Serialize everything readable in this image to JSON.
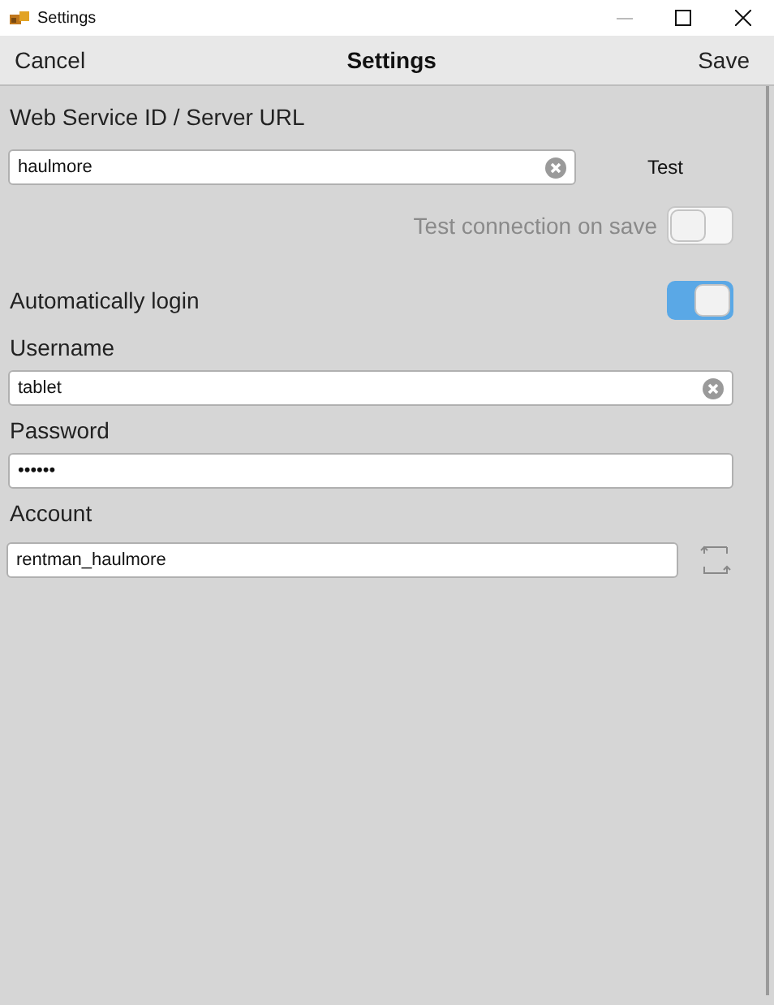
{
  "window": {
    "title": "Settings"
  },
  "nav": {
    "cancel": "Cancel",
    "title": "Settings",
    "save": "Save"
  },
  "server": {
    "label": "Web Service ID / Server URL",
    "value": "haulmore",
    "test": "Test"
  },
  "test_on_save": {
    "label": "Test connection on save",
    "on": false,
    "disabled": true
  },
  "auto_login": {
    "label": "Automatically login",
    "on": true
  },
  "username": {
    "label": "Username",
    "value": "tablet"
  },
  "password": {
    "label": "Password",
    "value": "••••••"
  },
  "account": {
    "label": "Account",
    "value": "rentman_haulmore"
  }
}
